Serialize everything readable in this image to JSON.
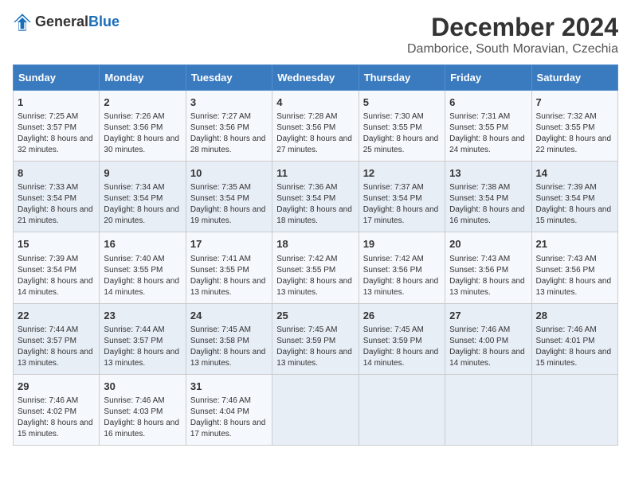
{
  "logo": {
    "text_general": "General",
    "text_blue": "Blue"
  },
  "header": {
    "title": "December 2024",
    "subtitle": "Damborice, South Moravian, Czechia"
  },
  "days_of_week": [
    "Sunday",
    "Monday",
    "Tuesday",
    "Wednesday",
    "Thursday",
    "Friday",
    "Saturday"
  ],
  "weeks": [
    [
      {
        "day": 1,
        "info": "Sunrise: 7:25 AM\nSunset: 3:57 PM\nDaylight: 8 hours and 32 minutes."
      },
      {
        "day": 2,
        "info": "Sunrise: 7:26 AM\nSunset: 3:56 PM\nDaylight: 8 hours and 30 minutes."
      },
      {
        "day": 3,
        "info": "Sunrise: 7:27 AM\nSunset: 3:56 PM\nDaylight: 8 hours and 28 minutes."
      },
      {
        "day": 4,
        "info": "Sunrise: 7:28 AM\nSunset: 3:56 PM\nDaylight: 8 hours and 27 minutes."
      },
      {
        "day": 5,
        "info": "Sunrise: 7:30 AM\nSunset: 3:55 PM\nDaylight: 8 hours and 25 minutes."
      },
      {
        "day": 6,
        "info": "Sunrise: 7:31 AM\nSunset: 3:55 PM\nDaylight: 8 hours and 24 minutes."
      },
      {
        "day": 7,
        "info": "Sunrise: 7:32 AM\nSunset: 3:55 PM\nDaylight: 8 hours and 22 minutes."
      }
    ],
    [
      {
        "day": 8,
        "info": "Sunrise: 7:33 AM\nSunset: 3:54 PM\nDaylight: 8 hours and 21 minutes."
      },
      {
        "day": 9,
        "info": "Sunrise: 7:34 AM\nSunset: 3:54 PM\nDaylight: 8 hours and 20 minutes."
      },
      {
        "day": 10,
        "info": "Sunrise: 7:35 AM\nSunset: 3:54 PM\nDaylight: 8 hours and 19 minutes."
      },
      {
        "day": 11,
        "info": "Sunrise: 7:36 AM\nSunset: 3:54 PM\nDaylight: 8 hours and 18 minutes."
      },
      {
        "day": 12,
        "info": "Sunrise: 7:37 AM\nSunset: 3:54 PM\nDaylight: 8 hours and 17 minutes."
      },
      {
        "day": 13,
        "info": "Sunrise: 7:38 AM\nSunset: 3:54 PM\nDaylight: 8 hours and 16 minutes."
      },
      {
        "day": 14,
        "info": "Sunrise: 7:39 AM\nSunset: 3:54 PM\nDaylight: 8 hours and 15 minutes."
      }
    ],
    [
      {
        "day": 15,
        "info": "Sunrise: 7:39 AM\nSunset: 3:54 PM\nDaylight: 8 hours and 14 minutes."
      },
      {
        "day": 16,
        "info": "Sunrise: 7:40 AM\nSunset: 3:55 PM\nDaylight: 8 hours and 14 minutes."
      },
      {
        "day": 17,
        "info": "Sunrise: 7:41 AM\nSunset: 3:55 PM\nDaylight: 8 hours and 13 minutes."
      },
      {
        "day": 18,
        "info": "Sunrise: 7:42 AM\nSunset: 3:55 PM\nDaylight: 8 hours and 13 minutes."
      },
      {
        "day": 19,
        "info": "Sunrise: 7:42 AM\nSunset: 3:56 PM\nDaylight: 8 hours and 13 minutes."
      },
      {
        "day": 20,
        "info": "Sunrise: 7:43 AM\nSunset: 3:56 PM\nDaylight: 8 hours and 13 minutes."
      },
      {
        "day": 21,
        "info": "Sunrise: 7:43 AM\nSunset: 3:56 PM\nDaylight: 8 hours and 13 minutes."
      }
    ],
    [
      {
        "day": 22,
        "info": "Sunrise: 7:44 AM\nSunset: 3:57 PM\nDaylight: 8 hours and 13 minutes."
      },
      {
        "day": 23,
        "info": "Sunrise: 7:44 AM\nSunset: 3:57 PM\nDaylight: 8 hours and 13 minutes."
      },
      {
        "day": 24,
        "info": "Sunrise: 7:45 AM\nSunset: 3:58 PM\nDaylight: 8 hours and 13 minutes."
      },
      {
        "day": 25,
        "info": "Sunrise: 7:45 AM\nSunset: 3:59 PM\nDaylight: 8 hours and 13 minutes."
      },
      {
        "day": 26,
        "info": "Sunrise: 7:45 AM\nSunset: 3:59 PM\nDaylight: 8 hours and 14 minutes."
      },
      {
        "day": 27,
        "info": "Sunrise: 7:46 AM\nSunset: 4:00 PM\nDaylight: 8 hours and 14 minutes."
      },
      {
        "day": 28,
        "info": "Sunrise: 7:46 AM\nSunset: 4:01 PM\nDaylight: 8 hours and 15 minutes."
      }
    ],
    [
      {
        "day": 29,
        "info": "Sunrise: 7:46 AM\nSunset: 4:02 PM\nDaylight: 8 hours and 15 minutes."
      },
      {
        "day": 30,
        "info": "Sunrise: 7:46 AM\nSunset: 4:03 PM\nDaylight: 8 hours and 16 minutes."
      },
      {
        "day": 31,
        "info": "Sunrise: 7:46 AM\nSunset: 4:04 PM\nDaylight: 8 hours and 17 minutes."
      },
      null,
      null,
      null,
      null
    ]
  ]
}
